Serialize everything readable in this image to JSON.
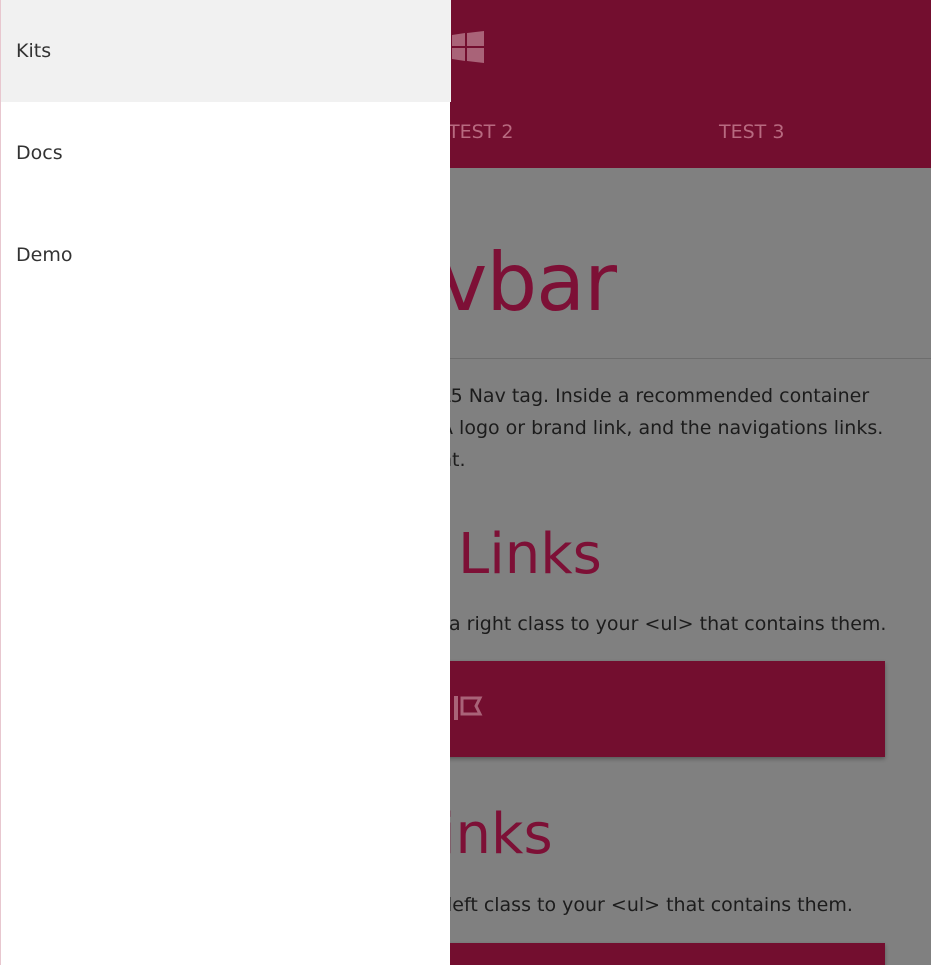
{
  "header": {
    "tabs": [
      {
        "label": "TEST 2"
      },
      {
        "label": "TEST 3"
      }
    ]
  },
  "content": {
    "title": "vbar",
    "intro_lines": [
      "L5 Nav tag. Inside a recommended container",
      "A logo or brand link, and the navigations links.",
      "ht."
    ],
    "right_links_heading": "Links",
    "right_links_text": "a right class to your <ul> that contains them.",
    "left_links_heading": "inks",
    "left_links_text": "left class to your <ul> that contains them."
  },
  "drawer": {
    "items": [
      {
        "label": "Kits",
        "active": true
      },
      {
        "label": "Docs",
        "active": false
      },
      {
        "label": "Demo",
        "active": false
      }
    ]
  },
  "colors": {
    "brand": "#730e2f",
    "overlay": "#808080",
    "drawer_bg": "#ffffff",
    "drawer_active": "#f1f1f1"
  },
  "icons": {
    "logo": "windows-logo-icon",
    "bar_icon": "flag-icon"
  }
}
